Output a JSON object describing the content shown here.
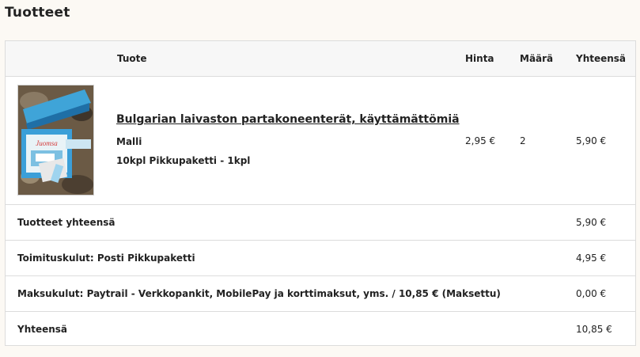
{
  "page": {
    "title": "Tuotteet"
  },
  "table": {
    "headers": {
      "product": "Tuote",
      "price": "Hinta",
      "quantity": "Määrä",
      "total": "Yhteensä"
    },
    "items": [
      {
        "name": "Bulgarian laivaston partakoneenterät, käyttämättömiä",
        "option_label": "Malli",
        "option_value": "10kpl Pikkupaketti - 1kpl",
        "price": "2,95 €",
        "quantity": "2",
        "total": "5,90 €"
      }
    ],
    "summary": [
      {
        "label": "Tuotteet yhteensä",
        "value": "5,90 €"
      },
      {
        "label": "Toimituskulut: Posti Pikkupaketti",
        "value": "4,95 €"
      },
      {
        "label": "Maksukulut: Paytrail - Verkkopankit, MobilePay ja korttimaksut, yms. / 10,85 € (Maksettu)",
        "value": "0,00 €"
      },
      {
        "label": "Yhteensä",
        "value": "10,85 €"
      }
    ]
  },
  "colors": {
    "page_background": "#fcf9f4",
    "header_background": "#f7f7f7",
    "border": "#dcdcdc",
    "text": "#222222"
  }
}
